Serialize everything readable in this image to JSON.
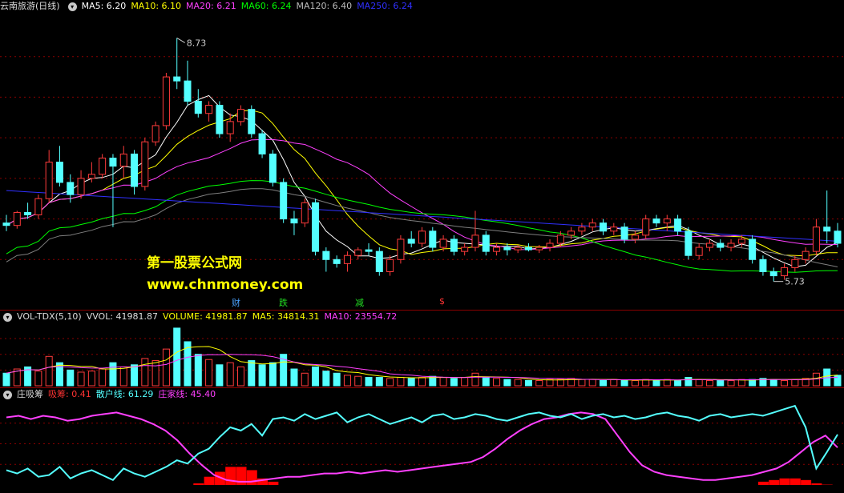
{
  "main_header": {
    "title": "云南旅游(日线)",
    "ma5": "MA5: 6.20",
    "ma10": "MA10: 6.10",
    "ma20": "MA20: 6.21",
    "ma60": "MA60: 6.24",
    "ma120": "MA120: 6.40",
    "ma250": "MA250: 6.24"
  },
  "vol_header": {
    "title": "VOL-TDX(5,10)",
    "vvol": "VVOL: 41981.87",
    "volume": "VOLUME: 41981.87",
    "ma5": "MA5: 34814.31",
    "ma10": "MA10: 23554.72"
  },
  "ind_header": {
    "title": "庄吸筹",
    "xichou": "吸筹: 0.41",
    "sanhu": "散户线: 61.29",
    "zhuangjia": "庄家线: 45.40"
  },
  "watermark": {
    "line1": "第一股票公式网",
    "line2": "www.chnmoney.com"
  },
  "event_marks": [
    {
      "text": "财",
      "color": "#4aa3ff"
    },
    {
      "text": "跌",
      "color": "#22dd22"
    },
    {
      "text": "减",
      "color": "#22dd22"
    },
    {
      "text": "$",
      "color": "#ff3333"
    }
  ],
  "annotations": {
    "high": "8.73",
    "low": "5.73"
  },
  "colors": {
    "up": "#ff3b3b",
    "down": "#54ffff",
    "ma5": "#ffffff",
    "ma10": "#ffff00",
    "ma20": "#ff40ff",
    "ma60": "#00ff00",
    "ma120": "#7f7f7f",
    "ma250": "#3030ff",
    "sanhu": "#54ffff",
    "zhuangjia": "#ff40ff",
    "xichou": "#ff0000"
  },
  "chart_data": [
    {
      "type": "candlestick",
      "title": "云南旅游(日线)",
      "ylim": [
        5.5,
        9.0
      ],
      "price_markers": {
        "high": 8.73,
        "low": 5.73
      },
      "candles": [
        [
          6.45,
          6.55,
          6.35,
          6.42
        ],
        [
          6.42,
          6.6,
          6.38,
          6.58
        ],
        [
          6.58,
          6.7,
          6.5,
          6.55
        ],
        [
          6.55,
          6.8,
          6.5,
          6.75
        ],
        [
          6.75,
          7.35,
          6.7,
          7.2
        ],
        [
          7.2,
          7.4,
          6.9,
          6.95
        ],
        [
          6.95,
          7.05,
          6.7,
          6.8
        ],
        [
          6.8,
          7.1,
          6.75,
          7.0
        ],
        [
          7.0,
          7.2,
          6.95,
          7.05
        ],
        [
          7.05,
          7.3,
          7.0,
          7.25
        ],
        [
          7.25,
          7.3,
          6.4,
          7.15
        ],
        [
          7.15,
          7.4,
          7.0,
          7.3
        ],
        [
          7.3,
          7.35,
          6.8,
          6.9
        ],
        [
          6.9,
          7.5,
          6.85,
          7.45
        ],
        [
          7.45,
          7.7,
          7.4,
          7.65
        ],
        [
          7.65,
          8.3,
          7.6,
          8.25
        ],
        [
          8.25,
          8.73,
          8.1,
          8.2
        ],
        [
          8.2,
          8.45,
          7.9,
          7.95
        ],
        [
          7.95,
          8.1,
          7.75,
          7.8
        ],
        [
          7.8,
          7.95,
          7.7,
          7.9
        ],
        [
          7.9,
          7.95,
          7.5,
          7.55
        ],
        [
          7.55,
          7.8,
          7.45,
          7.7
        ],
        [
          7.7,
          7.9,
          7.65,
          7.85
        ],
        [
          7.85,
          7.9,
          7.5,
          7.55
        ],
        [
          7.55,
          7.6,
          7.25,
          7.3
        ],
        [
          7.3,
          7.35,
          6.9,
          6.95
        ],
        [
          6.95,
          7.0,
          6.45,
          6.5
        ],
        [
          6.5,
          6.6,
          6.3,
          6.45
        ],
        [
          6.45,
          6.75,
          6.4,
          6.7
        ],
        [
          6.7,
          6.75,
          6.05,
          6.1
        ],
        [
          6.1,
          6.15,
          5.85,
          6.0
        ],
        [
          6.0,
          6.05,
          5.9,
          5.95
        ],
        [
          5.95,
          6.1,
          5.85,
          6.05
        ],
        [
          6.05,
          6.15,
          6.0,
          6.12
        ],
        [
          6.12,
          6.2,
          6.05,
          6.1
        ],
        [
          6.1,
          6.15,
          5.8,
          5.85
        ],
        [
          5.85,
          6.05,
          5.8,
          6.0
        ],
        [
          6.0,
          6.3,
          5.95,
          6.25
        ],
        [
          6.25,
          6.35,
          6.15,
          6.2
        ],
        [
          6.2,
          6.4,
          6.15,
          6.35
        ],
        [
          6.35,
          6.4,
          6.1,
          6.15
        ],
        [
          6.15,
          6.3,
          6.1,
          6.25
        ],
        [
          6.25,
          6.3,
          6.05,
          6.1
        ],
        [
          6.1,
          6.2,
          6.05,
          6.15
        ],
        [
          6.15,
          6.6,
          6.1,
          6.3
        ],
        [
          6.3,
          6.35,
          6.05,
          6.1
        ],
        [
          6.1,
          6.2,
          6.05,
          6.15
        ],
        [
          6.15,
          6.2,
          6.05,
          6.12
        ],
        [
          6.12,
          6.18,
          6.08,
          6.15
        ],
        [
          6.15,
          6.2,
          6.1,
          6.12
        ],
        [
          6.12,
          6.18,
          6.08,
          6.15
        ],
        [
          6.15,
          6.25,
          6.1,
          6.2
        ],
        [
          6.2,
          6.35,
          6.15,
          6.3
        ],
        [
          6.3,
          6.4,
          6.25,
          6.35
        ],
        [
          6.35,
          6.45,
          6.3,
          6.4
        ],
        [
          6.4,
          6.5,
          6.35,
          6.45
        ],
        [
          6.45,
          6.5,
          6.3,
          6.35
        ],
        [
          6.35,
          6.45,
          6.3,
          6.4
        ],
        [
          6.4,
          6.45,
          6.2,
          6.25
        ],
        [
          6.25,
          6.35,
          6.2,
          6.3
        ],
        [
          6.3,
          6.55,
          6.25,
          6.5
        ],
        [
          6.5,
          6.55,
          6.4,
          6.45
        ],
        [
          6.45,
          6.55,
          6.35,
          6.5
        ],
        [
          6.5,
          6.55,
          6.3,
          6.35
        ],
        [
          6.35,
          6.4,
          6.0,
          6.05
        ],
        [
          6.05,
          6.2,
          6.0,
          6.15
        ],
        [
          6.15,
          6.25,
          6.1,
          6.2
        ],
        [
          6.2,
          6.25,
          6.1,
          6.15
        ],
        [
          6.15,
          6.25,
          6.1,
          6.2
        ],
        [
          6.2,
          6.3,
          6.15,
          6.25
        ],
        [
          6.25,
          6.3,
          5.95,
          6.0
        ],
        [
          6.0,
          6.05,
          5.8,
          5.85
        ],
        [
          5.85,
          5.9,
          5.73,
          5.8
        ],
        [
          5.8,
          5.95,
          5.75,
          5.9
        ],
        [
          5.9,
          6.05,
          5.85,
          6.0
        ],
        [
          6.0,
          6.15,
          5.95,
          6.1
        ],
        [
          6.1,
          6.5,
          6.05,
          6.4
        ],
        [
          6.4,
          6.85,
          6.2,
          6.35
        ],
        [
          6.35,
          6.45,
          6.15,
          6.2
        ]
      ]
    },
    {
      "type": "bar",
      "title": "VOL-TDX(5,10)",
      "values": [
        12,
        16,
        18,
        14,
        28,
        22,
        15,
        13,
        14,
        16,
        22,
        18,
        20,
        26,
        24,
        35,
        55,
        42,
        30,
        25,
        20,
        22,
        18,
        24,
        20,
        22,
        30,
        16,
        12,
        18,
        14,
        12,
        10,
        9,
        8,
        8,
        7,
        8,
        7,
        8,
        9,
        8,
        7,
        8,
        12,
        8,
        7,
        6,
        6,
        5,
        5,
        6,
        6,
        7,
        6,
        6,
        5,
        6,
        5,
        5,
        6,
        5,
        6,
        5,
        8,
        6,
        5,
        5,
        5,
        6,
        6,
        7,
        6,
        5,
        6,
        7,
        12,
        16,
        10
      ]
    },
    {
      "type": "line",
      "title": "庄吸筹",
      "series": [
        {
          "name": "散户线",
          "values": [
            18,
            14,
            20,
            10,
            12,
            22,
            8,
            14,
            18,
            12,
            6,
            20,
            14,
            10,
            16,
            22,
            30,
            26,
            38,
            44,
            58,
            70,
            66,
            74,
            60,
            80,
            82,
            78,
            86,
            80,
            84,
            88,
            76,
            82,
            86,
            80,
            74,
            78,
            82,
            76,
            84,
            86,
            80,
            82,
            86,
            84,
            80,
            78,
            82,
            86,
            88,
            84,
            82,
            86,
            80,
            84,
            86,
            82,
            84,
            80,
            82,
            86,
            88,
            84,
            82,
            78,
            84,
            86,
            82,
            84,
            86,
            84,
            88,
            92,
            96,
            70,
            20,
            40,
            61.29
          ]
        },
        {
          "name": "庄家线",
          "values": [
            82,
            84,
            80,
            84,
            82,
            78,
            80,
            84,
            86,
            88,
            84,
            80,
            74,
            66,
            54,
            38,
            24,
            12,
            6,
            4,
            4,
            6,
            8,
            10,
            10,
            12,
            14,
            14,
            16,
            14,
            16,
            18,
            16,
            18,
            20,
            22,
            24,
            26,
            28,
            34,
            44,
            56,
            66,
            74,
            80,
            82,
            86,
            88,
            86,
            80,
            60,
            40,
            24,
            16,
            12,
            10,
            8,
            6,
            6,
            8,
            10,
            12,
            16,
            20,
            28,
            40,
            52,
            60,
            45.4
          ]
        },
        {
          "name": "吸筹",
          "values": [
            0,
            0,
            0,
            0,
            0,
            0,
            0,
            0,
            0,
            0,
            0,
            0,
            0,
            0,
            0,
            0,
            0,
            0,
            2,
            10,
            16,
            22,
            22,
            18,
            8,
            4,
            0,
            0,
            0,
            0,
            0,
            0,
            0,
            0,
            0,
            0,
            0,
            0,
            0,
            0,
            0,
            0,
            0,
            0,
            0,
            0,
            0,
            0,
            0,
            0,
            0,
            0,
            0,
            0,
            0,
            0,
            0,
            0,
            0,
            0,
            0,
            0,
            0,
            0,
            0,
            0,
            0,
            0,
            0,
            0,
            0,
            4,
            6,
            8,
            8,
            6,
            2,
            0.41,
            0
          ]
        }
      ]
    }
  ]
}
